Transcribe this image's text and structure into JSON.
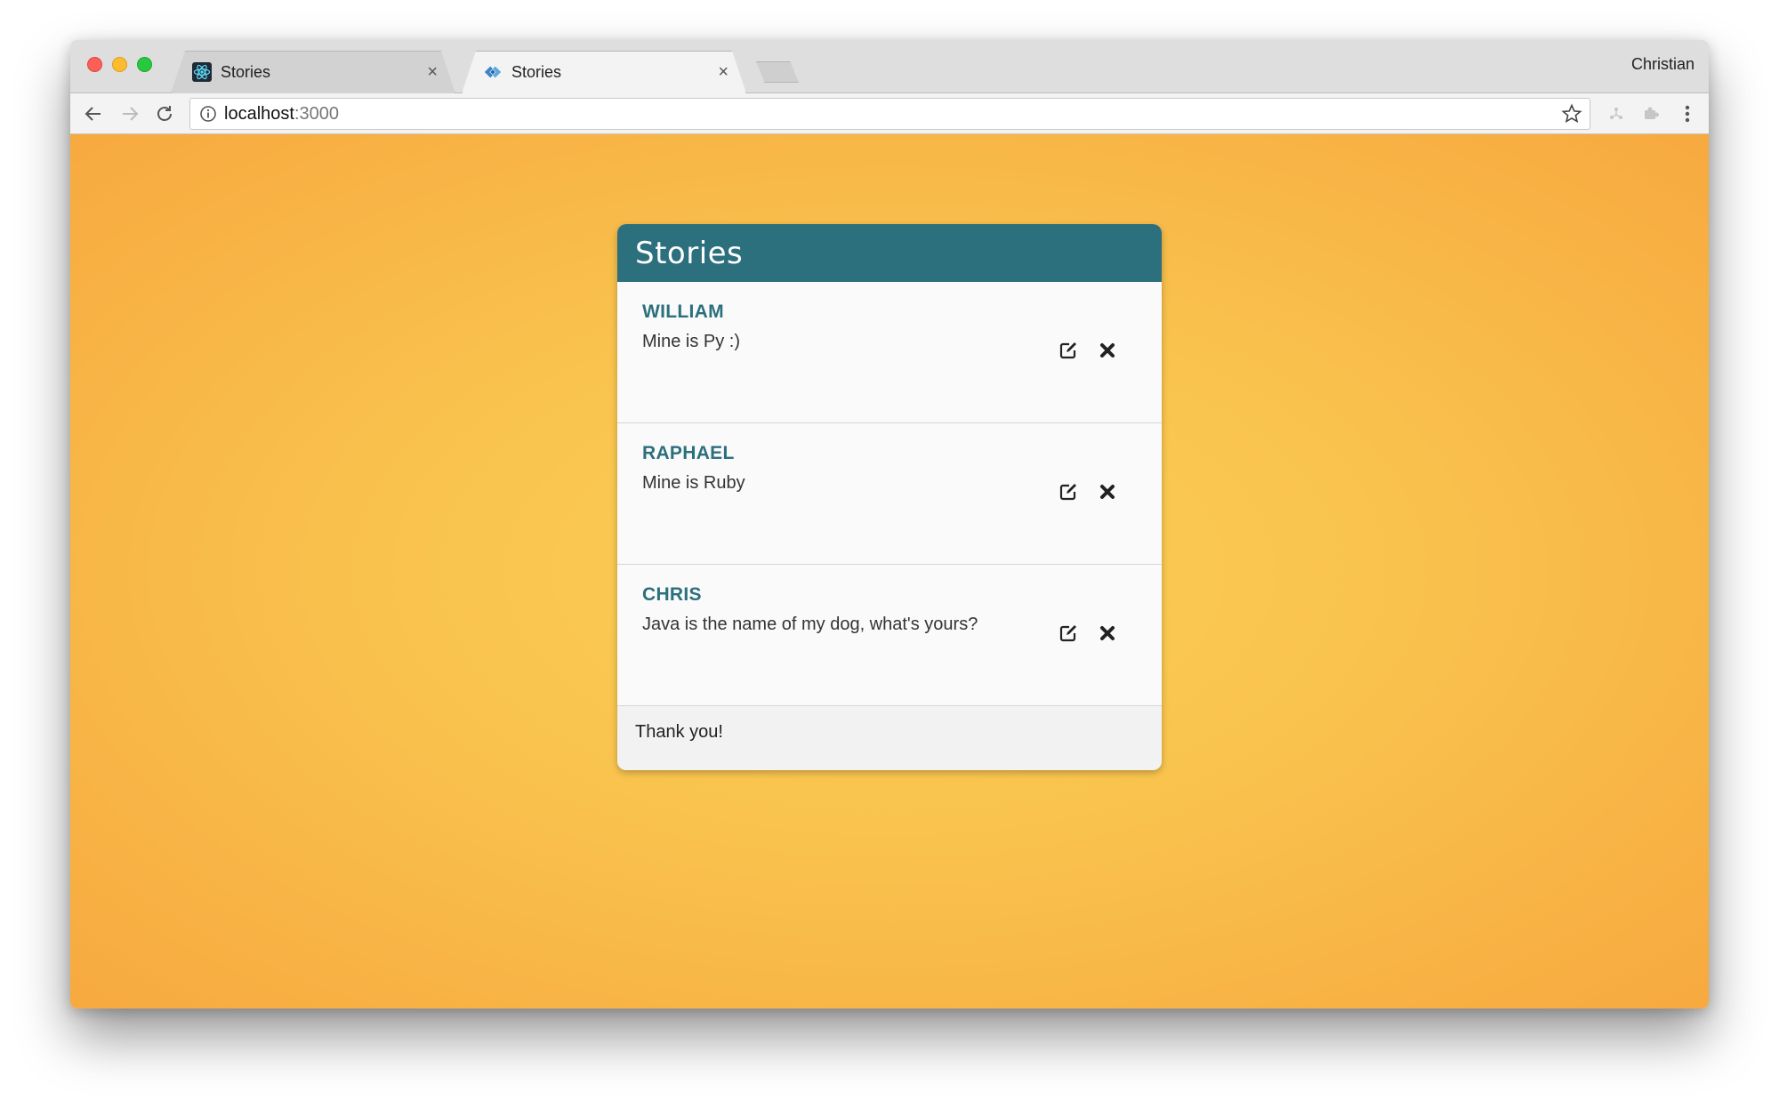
{
  "browser": {
    "tabs": [
      {
        "title": "Stories",
        "favicon": "react-atom-icon",
        "active": false
      },
      {
        "title": "Stories",
        "favicon": "code-diamond-icon",
        "active": true
      }
    ],
    "tab_close_glyph": "×",
    "profile_name": "Christian",
    "address": {
      "host": "localhost",
      "port": ":3000"
    }
  },
  "page": {
    "card": {
      "title": "Stories",
      "stories": [
        {
          "author": "WILLIAM",
          "text": "Mine is Py :)"
        },
        {
          "author": "RAPHAEL",
          "text": "Mine is Ruby"
        },
        {
          "author": "CHRIS",
          "text": "Java is the name of my dog, what's yours?"
        }
      ],
      "footer": "Thank you!"
    }
  },
  "colors": {
    "header": "#2c6f7d",
    "author": "#2c6f7d",
    "background_center": "#fbcf55",
    "background_edge": "#f7a93f"
  }
}
